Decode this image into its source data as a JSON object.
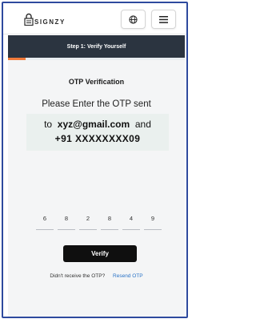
{
  "header": {
    "logo_text": "SIGNZY",
    "globe_icon": "globe-icon",
    "menu_icon": "hamburger-menu-icon"
  },
  "banner": {
    "step_label": "Step 1: Verify Yourself"
  },
  "progress": {
    "fraction": 0.1
  },
  "otp": {
    "title": "OTP Verification",
    "instruction": "Please Enter the OTP sent",
    "to_prefix": "to",
    "email": "xyz@gmail.com",
    "and_word": "and",
    "phone": "+91 XXXXXXXX09",
    "digits": [
      "6",
      "8",
      "2",
      "8",
      "4",
      "9"
    ]
  },
  "actions": {
    "verify_label": "Verify",
    "resend_prompt": "Didn't receive the OTP?",
    "resend_link": "Resend OTP"
  },
  "colors": {
    "frame": "#2e4a9e",
    "banner": "#2b3440",
    "accent": "#f07a3a",
    "link": "#2a73c7"
  }
}
